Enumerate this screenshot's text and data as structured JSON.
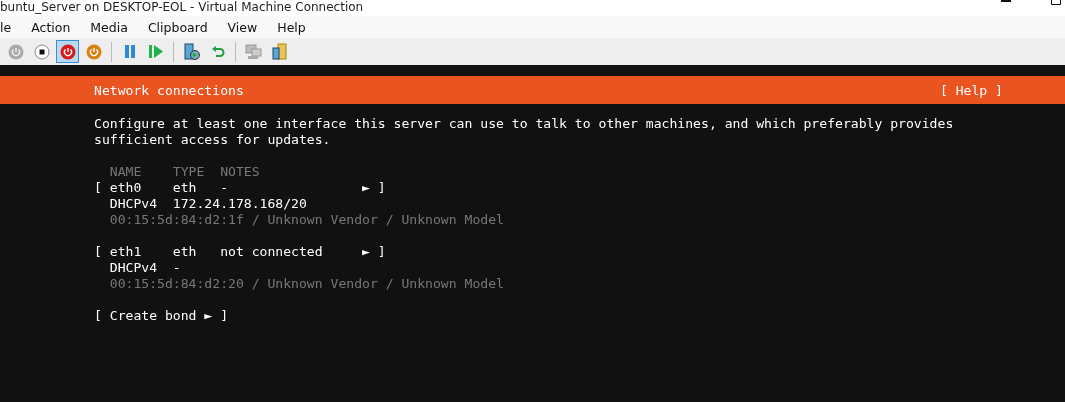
{
  "window": {
    "title": "buntu_Server on DESKTOP-EOL - Virtual Machine Connection"
  },
  "menu": [
    "le",
    "Action",
    "Media",
    "Clipboard",
    "View",
    "Help"
  ],
  "toolbar": [
    {
      "kind": "power-grey",
      "selected": false
    },
    {
      "kind": "stop",
      "selected": false
    },
    {
      "kind": "power-red",
      "selected": true
    },
    {
      "kind": "power-orange",
      "selected": false
    },
    {
      "kind": "sep"
    },
    {
      "kind": "pause",
      "selected": false
    },
    {
      "kind": "play",
      "selected": false
    },
    {
      "kind": "sep"
    },
    {
      "kind": "checkpoint",
      "selected": false
    },
    {
      "kind": "revert",
      "selected": false
    },
    {
      "kind": "sep"
    },
    {
      "kind": "session",
      "selected": false
    },
    {
      "kind": "share",
      "selected": false
    }
  ],
  "header": {
    "title": "Network connections",
    "help": "[ Help ]"
  },
  "intro": "Configure at least one interface this server can use to talk to other machines, and which preferably provides sufficient access for updates.",
  "columns": [
    "NAME",
    "TYPE",
    "NOTES"
  ],
  "interfaces": [
    {
      "open": "[",
      "name": "eth0",
      "type": "eth",
      "notes": "-",
      "arrow": "►",
      "close": "]",
      "method": "DHCPv4",
      "address": "172.24.178.168/20",
      "hardware": "00:15:5d:84:d2:1f / Unknown Vendor / Unknown Model"
    },
    {
      "open": "[",
      "name": "eth1",
      "type": "eth",
      "notes": "not connected",
      "arrow": "►",
      "close": "]",
      "method": "DHCPv4",
      "address": "-",
      "hardware": "00:15:5d:84:d2:20 / Unknown Vendor / Unknown Model"
    }
  ],
  "create_bond": "[ Create bond ► ]"
}
